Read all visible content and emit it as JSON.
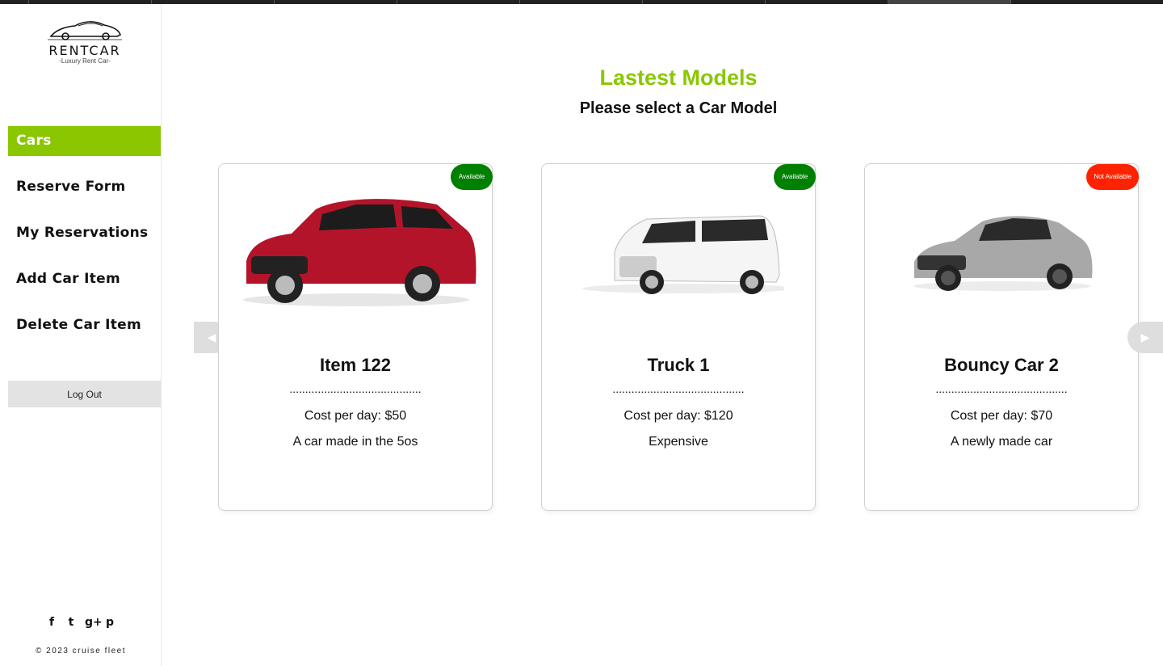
{
  "brand": {
    "name": "RENTCAR",
    "tagline": "-Luxury Rent Car-"
  },
  "nav": {
    "items": [
      {
        "label": "Cars",
        "active": true
      },
      {
        "label": "Reserve Form",
        "active": false
      },
      {
        "label": "My Reservations",
        "active": false
      },
      {
        "label": "Add Car Item",
        "active": false
      },
      {
        "label": "Delete Car Item",
        "active": false
      }
    ],
    "logout_label": "Log Out"
  },
  "social": {
    "icons": [
      "facebook-icon",
      "twitter-icon",
      "google-plus-icon",
      "pinterest-icon"
    ],
    "glyphs": [
      "f",
      "t",
      "g+",
      "p"
    ]
  },
  "footer": {
    "copyright": "© 2023 cruise fleet"
  },
  "main": {
    "title": "Lastest Models",
    "subtitle": "Please select a Car Model"
  },
  "cars": [
    {
      "name": "Item 122",
      "dots": "..........................................",
      "cost": "Cost per day: $50",
      "description": "A car made in the 5os",
      "status": "Available",
      "color": "#b3142a"
    },
    {
      "name": "Truck 1",
      "dots": "..........................................",
      "cost": "Cost per day: $120",
      "description": "Expensive",
      "status": "Available",
      "color": "#f4f4f4"
    },
    {
      "name": "Bouncy Car 2",
      "dots": "..........................................",
      "cost": "Cost per day: $70",
      "description": "A newly made car",
      "status": "Not Available",
      "color": "#a8a8a8"
    }
  ],
  "colors": {
    "accent": "#8ac700",
    "available": "#008000",
    "not_available": "#ff2200"
  }
}
